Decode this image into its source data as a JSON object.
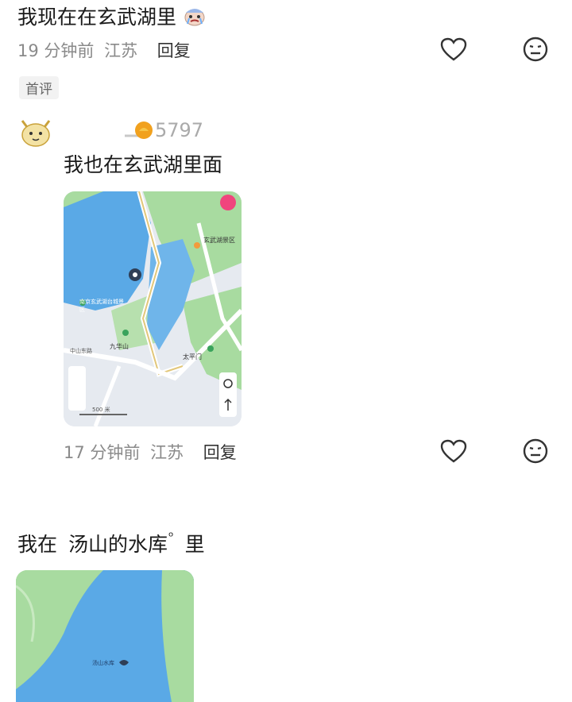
{
  "comment1": {
    "text": "我现在在玄武湖里",
    "time": "19 分钟前",
    "location": "江苏",
    "reply": "回复"
  },
  "badge": "首评",
  "comment2": {
    "likes": "5797",
    "text": "我也在玄武湖里面",
    "map_labels": {
      "district": "玄武湖景区",
      "north": "九华山",
      "lake_area": "南京玄武湖台城景区",
      "temple": "太平门",
      "road": "中山东路",
      "scale": "500 米"
    },
    "time": "17 分钟前",
    "location": "江苏",
    "reply": "回复"
  },
  "comment3": {
    "text_prefix": "我在",
    "text_link": "汤山的水库",
    "text_suffix": "里",
    "map_label": "汤山水库"
  },
  "colors": {
    "water": "#5aa9e6",
    "green": "#a8dba0",
    "road": "#e8ebf0"
  }
}
